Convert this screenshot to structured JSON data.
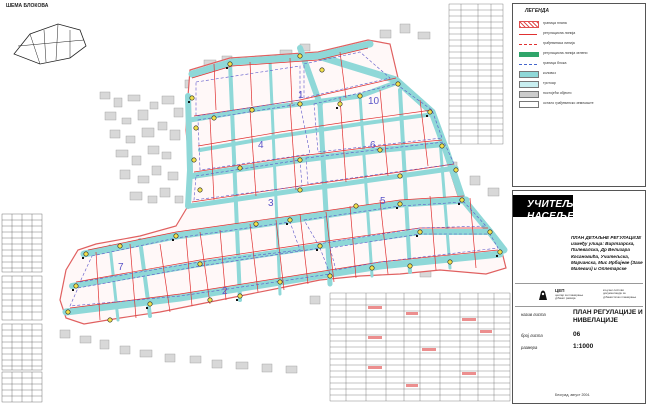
{
  "inset": {
    "title": "ШЕМА БЛОКОВА"
  },
  "legend": {
    "title": "ЛЕГЕНДА",
    "items": [
      {
        "symbol": "red-hatch-box",
        "text": "граница плана",
        "color": "#e05050"
      },
      {
        "symbol": "red-line",
        "text": "регулациона линија",
        "color": "#e03030"
      },
      {
        "symbol": "red-dash-line",
        "text": "грађевинска линија",
        "color": "#e03030"
      },
      {
        "symbol": "green-bar",
        "text": "регулациона линија зелени",
        "color": "#2fa56a"
      },
      {
        "symbol": "blue-dash-line",
        "text": "граница блока",
        "color": "#4466cc"
      },
      {
        "symbol": "cyan-fill",
        "text": "коловоз",
        "color": "#8fd8d8"
      },
      {
        "symbol": "light-cyan-fill",
        "text": "тротоар",
        "color": "#c8eef0"
      },
      {
        "symbol": "grey-fill",
        "text": "постојећи објекти",
        "color": "#cccccc"
      },
      {
        "symbol": "white-box",
        "text": "остало грађевинско земљиште",
        "color": "#ffffff"
      }
    ]
  },
  "title_block": {
    "heading_line1": "УЧИТЕЉСКО",
    "heading_line2": "НАСЕЉЕ",
    "plan_title": "ПЛАН ДЕТАЉНЕ РЕГУЛАЦИЈЕ између улица: Виртзарска, Пилевалска, Др Велизара Косановића, Учитељска, Марчанска, Мис Ирбијеве (Захе Малевич) и Оплетарске",
    "org_name": "ЦЕП",
    "org_sub": "центар за планирање урбаног развоја",
    "org_right": "кључни листови документације за урбанистичко планирање",
    "sheet_name_label": "назив листа",
    "sheet_name_value": "ПЛАН РЕГУЛАЦИЈЕ И НИВЕЛАЦИЈЕ",
    "sheet_number_label": "број листа",
    "sheet_number_value": "06",
    "scale_label": "размера",
    "scale_value": "1:1000",
    "date": "Београд, август 2004."
  },
  "block_labels": [
    "1",
    "2",
    "3",
    "4",
    "5",
    "6",
    "7",
    "8",
    "9",
    "10"
  ],
  "colors": {
    "road": "#8fd8d8",
    "sidewalk": "#c8eef0",
    "regulation": "#e03030",
    "block_border": "#5a54c8",
    "node": "#f2e04a",
    "node_stroke": "#222222",
    "background_buildings": "#c8c8c8"
  }
}
